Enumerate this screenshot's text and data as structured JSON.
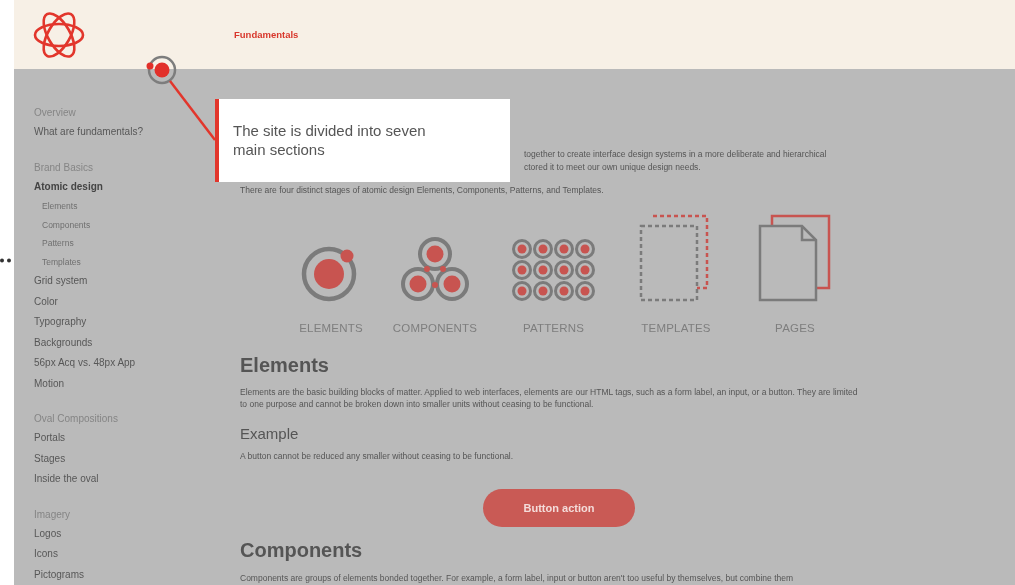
{
  "header": {
    "title": "Fundamentals"
  },
  "sidebar": {
    "sections": [
      {
        "heading": "Overview",
        "items": [
          {
            "label": "What are fundamentals?",
            "selected": false
          }
        ]
      },
      {
        "heading": "Brand Basics",
        "items": [
          {
            "label": "Atomic design",
            "selected": true,
            "children": [
              {
                "label": "Elements",
                "selected": false
              },
              {
                "label": "Components",
                "selected": false
              },
              {
                "label": "Patterns",
                "selected": false
              },
              {
                "label": "Templates",
                "selected": false
              }
            ]
          },
          {
            "label": "Grid system",
            "selected": false
          },
          {
            "label": "Color",
            "selected": false
          },
          {
            "label": "Typography",
            "selected": false
          },
          {
            "label": "Backgrounds",
            "selected": false
          },
          {
            "label": "56px Acq vs. 48px App",
            "selected": false
          },
          {
            "label": "Motion",
            "selected": false
          }
        ]
      },
      {
        "heading": "Oval Compositions",
        "items": [
          {
            "label": "Portals",
            "selected": false
          },
          {
            "label": "Stages",
            "selected": false
          },
          {
            "label": "Inside the oval",
            "selected": false
          }
        ]
      },
      {
        "heading": "Imagery",
        "items": [
          {
            "label": "Logos",
            "selected": false
          },
          {
            "label": "Icons",
            "selected": false
          },
          {
            "label": "Pictograms",
            "selected": false
          }
        ]
      }
    ]
  },
  "callout": {
    "text": "The site is divided into seven main sections"
  },
  "intro": {
    "lines": [
      "together to create interface design systems in a more deliberate and hierarchical",
      "ctored it to meet our own unique design needs."
    ]
  },
  "stages_text": "There are four distinct stages of atomic design Elements, Components, Patterns, and Templates.",
  "stages": [
    {
      "kind": "elements",
      "label": "ELEMENTS"
    },
    {
      "kind": "components",
      "label": "COMPONENTS"
    },
    {
      "kind": "patterns",
      "label": "PATTERNS"
    },
    {
      "kind": "templates",
      "label": "TEMPLATES"
    },
    {
      "kind": "pages",
      "label": "PAGES"
    }
  ],
  "elements_section": {
    "heading": "Elements",
    "text": "Elements are the basic building blocks of matter. Applied to web interfaces, elements are our HTML tags, such as a form label, an input, or a button. They are limited to one purpose and cannot be broken down into smaller units without ceasing to be functional.",
    "example_heading": "Example",
    "example_text": "A button cannot be reduced any smaller without ceasing to be functional.",
    "button": "Button action"
  },
  "components_section": {
    "heading": "Components",
    "text": "Components are groups of elements bonded together. For example, a form label, input or button aren't too useful by themselves, but combine them"
  }
}
